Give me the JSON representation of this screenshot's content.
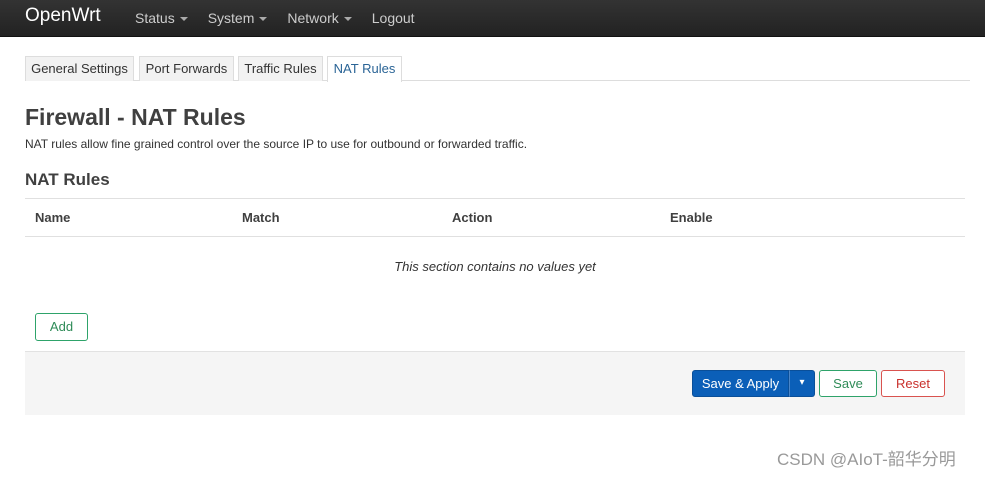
{
  "header": {
    "brand": "OpenWrt",
    "menu": [
      "Status",
      "System",
      "Network",
      "Logout"
    ]
  },
  "tabs": [
    "General Settings",
    "Port Forwards",
    "Traffic Rules",
    "NAT Rules"
  ],
  "page": {
    "title": "Firewall - NAT Rules",
    "description": "NAT rules allow fine grained control over the source IP to use for outbound or forwarded traffic."
  },
  "section": {
    "title": "NAT Rules",
    "columns": [
      "Name",
      "Match",
      "Action",
      "Enable"
    ],
    "empty_text": "This section contains no values yet",
    "add_label": "Add"
  },
  "actions": {
    "save_apply": "Save & Apply",
    "save": "Save",
    "reset": "Reset"
  },
  "watermark": "CSDN @AIoT-韶华分明",
  "colors": {
    "navbar": "#222222",
    "primary": "#0b5fb8",
    "positive": "#2e8b57",
    "negative": "#c9302c",
    "active_tab": "#2a6496"
  }
}
